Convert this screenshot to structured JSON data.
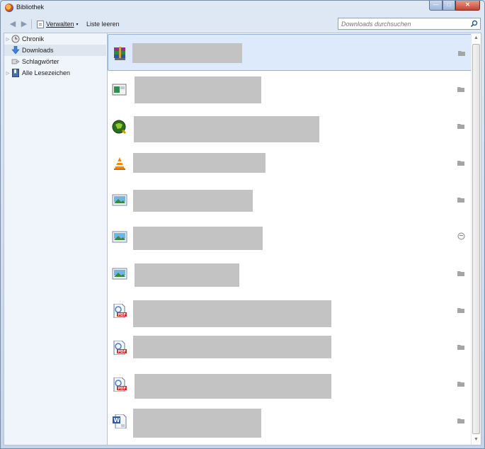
{
  "window": {
    "title": "Bibliothek",
    "min_label": "0",
    "max_label": "1",
    "close_label": "r"
  },
  "toolbar": {
    "back_label": "◀",
    "forward_label": "▶",
    "organize_label": "Verwalten",
    "organize_caret": "▾",
    "clear_label": "Liste leeren"
  },
  "search": {
    "placeholder": "Downloads durchsuchen",
    "value": ""
  },
  "sidebar": {
    "items": [
      {
        "label": "Chronik",
        "icon": "clock-icon",
        "expandable": true
      },
      {
        "label": "Downloads",
        "icon": "download-arrow-icon",
        "expandable": false,
        "selected": true
      },
      {
        "label": "Schlagwörter",
        "icon": "tag-icon",
        "expandable": false
      },
      {
        "label": "Alle Lesezeichen",
        "icon": "bookmarks-icon",
        "expandable": true
      }
    ]
  },
  "downloads": [
    {
      "icon": "winrar-archive-icon",
      "action_icon": "open-folder-icon",
      "selected": true
    },
    {
      "icon": "application-window-icon",
      "action_icon": "open-folder-icon"
    },
    {
      "icon": "green-globe-app-icon",
      "action_icon": "open-folder-icon"
    },
    {
      "icon": "vlc-cone-icon",
      "action_icon": "open-folder-icon"
    },
    {
      "icon": "image-file-icon",
      "action_icon": "open-folder-icon"
    },
    {
      "icon": "image-file-icon",
      "action_icon": "retry-icon"
    },
    {
      "icon": "image-file-icon",
      "action_icon": "open-folder-icon"
    },
    {
      "icon": "pdf-file-icon",
      "action_icon": "open-folder-icon"
    },
    {
      "icon": "pdf-file-icon",
      "action_icon": "open-folder-icon"
    },
    {
      "icon": "pdf-file-icon",
      "action_icon": "open-folder-icon"
    },
    {
      "icon": "word-document-icon",
      "action_icon": "open-folder-icon"
    }
  ],
  "colors": {
    "selection": "#dceafb",
    "redaction": "#c3c3c3",
    "sidebar_bg": "#f0f5fb"
  }
}
